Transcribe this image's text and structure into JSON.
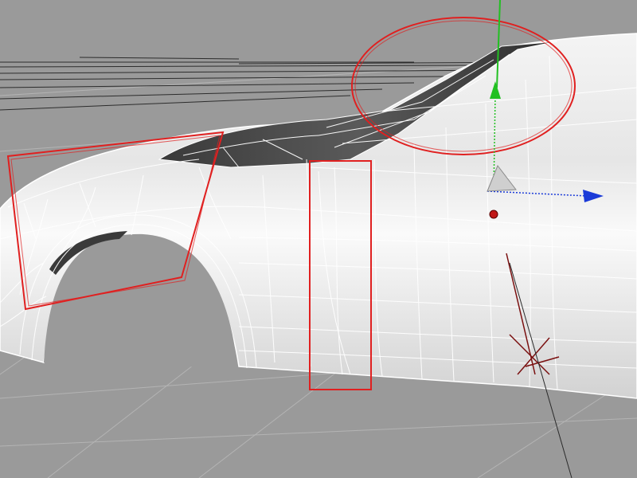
{
  "viewport": {
    "name": "3d-modeling-viewport",
    "background_color": "#9a9a9a",
    "grid_color": "#b4b4b4",
    "wireframe_color": "#ffffff",
    "highlight_color": "#e02020"
  },
  "model": {
    "object": "car-body-quarter-panel",
    "render_mode": "shaded-with-wireframe"
  },
  "annotations": [
    {
      "shape": "polygon",
      "target": "wheel-arch-front",
      "color": "#e02020"
    },
    {
      "shape": "rectangle",
      "target": "door-seam",
      "color": "#e02020"
    },
    {
      "shape": "ellipse",
      "target": "roof-pillar",
      "color": "#e02020"
    }
  ],
  "gizmo": {
    "type": "move-manipulator",
    "axes": [
      {
        "axis": "y",
        "color": "#22c022"
      },
      {
        "axis": "x",
        "color": "#1a3ad8"
      }
    ],
    "pivot_color": "#c01818"
  },
  "axis_marker": {
    "color": "#7a1010"
  }
}
